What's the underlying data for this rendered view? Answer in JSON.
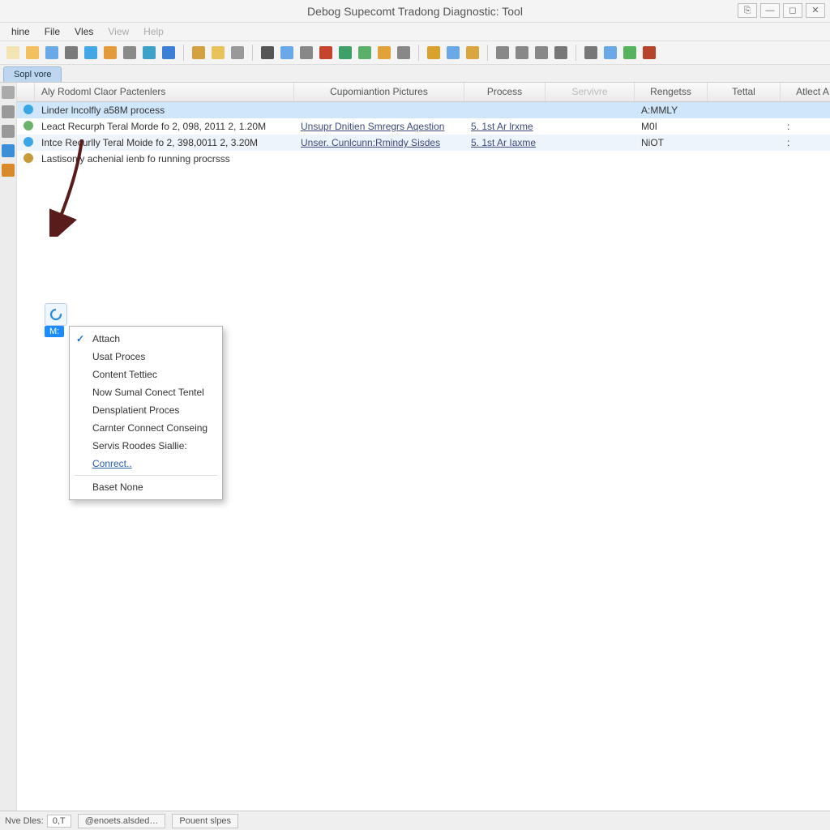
{
  "window": {
    "title": "Debog Supecomt Tradong Diagnostic: Tool"
  },
  "menu": {
    "items": [
      "hine",
      "File",
      "Vles",
      "View",
      "Help"
    ],
    "disabled_from": 3
  },
  "toolbar_icons": [
    {
      "name": "file-icon",
      "color": "#f3e6b2"
    },
    {
      "name": "open-icon",
      "color": "#f3c060"
    },
    {
      "name": "save-icon",
      "color": "#6aa8e8"
    },
    {
      "name": "photo-icon",
      "color": "#7a7a7a"
    },
    {
      "name": "refresh-icon",
      "color": "#43a6e6"
    },
    {
      "name": "tag-icon",
      "color": "#e39a3a"
    },
    {
      "name": "print-icon",
      "color": "#8a8a8a"
    },
    {
      "name": "globe-icon",
      "color": "#3da1c8"
    },
    {
      "name": "link-icon",
      "color": "#3b7fd6"
    },
    {
      "name": "sep"
    },
    {
      "name": "book-icon",
      "color": "#d4a040"
    },
    {
      "name": "copy-icon",
      "color": "#e8c35a"
    },
    {
      "name": "list-icon",
      "color": "#999"
    },
    {
      "name": "sep"
    },
    {
      "name": "pencil-icon",
      "color": "#555"
    },
    {
      "name": "disk-icon",
      "color": "#6aa8e8"
    },
    {
      "name": "gear-icon",
      "color": "#888"
    },
    {
      "name": "stop-icon",
      "color": "#c8432b"
    },
    {
      "name": "network-icon",
      "color": "#3f9f66"
    },
    {
      "name": "grid-icon",
      "color": "#5ab06a"
    },
    {
      "name": "palette-icon",
      "color": "#e2a23a"
    },
    {
      "name": "chevron-down-icon",
      "color": "#888"
    },
    {
      "name": "sep"
    },
    {
      "name": "world-icon",
      "color": "#d8a22c"
    },
    {
      "name": "window-icon",
      "color": "#6aa8e8"
    },
    {
      "name": "browse-icon",
      "color": "#d9a640"
    },
    {
      "name": "sep"
    },
    {
      "name": "search-icon",
      "color": "#888"
    },
    {
      "name": "pointer-icon",
      "color": "#888"
    },
    {
      "name": "chevron-down-icon",
      "color": "#888"
    },
    {
      "name": "scissors-icon",
      "color": "#777"
    },
    {
      "name": "sep"
    },
    {
      "name": "arrows-icon",
      "color": "#777"
    },
    {
      "name": "table-icon",
      "color": "#6aa8e8"
    },
    {
      "name": "circle-icon",
      "color": "#55b35b"
    },
    {
      "name": "block-icon",
      "color": "#b8432b"
    }
  ],
  "tab": {
    "label": "Sopl vore"
  },
  "columns": [
    {
      "k": "c0",
      "label": ""
    },
    {
      "k": "c1",
      "label": "Aly Rodoml Claor Pactenlers"
    },
    {
      "k": "c2",
      "label": "Cupomiantion Pictures"
    },
    {
      "k": "c3",
      "label": "Process"
    },
    {
      "k": "c4",
      "label": "Servivre",
      "disabled": true
    },
    {
      "k": "c5",
      "label": "Rengetss"
    },
    {
      "k": "c6",
      "label": "Tettal"
    },
    {
      "k": "c7",
      "label": "Atlect A"
    }
  ],
  "rows": [
    {
      "hl": true,
      "icon": "#3aa6e6",
      "c1": "Linder lncolfly a58M process",
      "c2": "",
      "c3": "",
      "c5": "A:MMLY",
      "c6": "",
      "c7": ""
    },
    {
      "icon": "#6ab36a",
      "c1": "Leact Recurph Teral Morde fo 2, 098, 2011 2, 1.20M",
      "c2": "Unsupr Dnitien Smregrs Aqestion",
      "c3": "5. 1st Ar lrxme",
      "c5": "M0I",
      "c6": "",
      "c7": ":"
    },
    {
      "stripe": true,
      "icon": "#3aa6e6",
      "c1": "Intce Recurlly Teral Moide fo 2, 398,0011 2, 3.20M",
      "c2": "Unser. Cunlcunn:Rmindy Sisdes",
      "c3": "5. 1st Ar Iaxme",
      "c5": "NiOT",
      "c6": "",
      "c7": ":"
    },
    {
      "icon": "#c89a3a",
      "c1": "Lastisonly achenial ienb fo running procrsss",
      "c2": "",
      "c3": "",
      "c5": "",
      "c6": "",
      "c7": ""
    }
  ],
  "proc_label": "M:",
  "context_menu": [
    {
      "label": "Attach",
      "check": true
    },
    {
      "label": "Usat Proces"
    },
    {
      "label": "Content Tettiec"
    },
    {
      "label": "Now Sumal Conect Tentel"
    },
    {
      "label": "Densplatient Proces"
    },
    {
      "label": "Carnter Connect Conseing"
    },
    {
      "label": "Servis Roodes Siallie:"
    },
    {
      "label": "Conrect..",
      "link": true
    },
    {
      "sep": true
    },
    {
      "label": "Baset None"
    }
  ],
  "status": {
    "label1": "Nve Dles:",
    "value1": "0,T",
    "btn1": "@enoets.alsded…",
    "btn2": "Pouent slpes"
  },
  "leftbar_icons": [
    {
      "name": "panel-icon",
      "color": "#aaa"
    },
    {
      "name": "grid-icon",
      "color": "#999"
    },
    {
      "name": "callout-icon",
      "color": "#999"
    },
    {
      "name": "search-icon",
      "color": "#3a8fd6"
    },
    {
      "name": "warning-icon",
      "color": "#d98a2a"
    }
  ]
}
